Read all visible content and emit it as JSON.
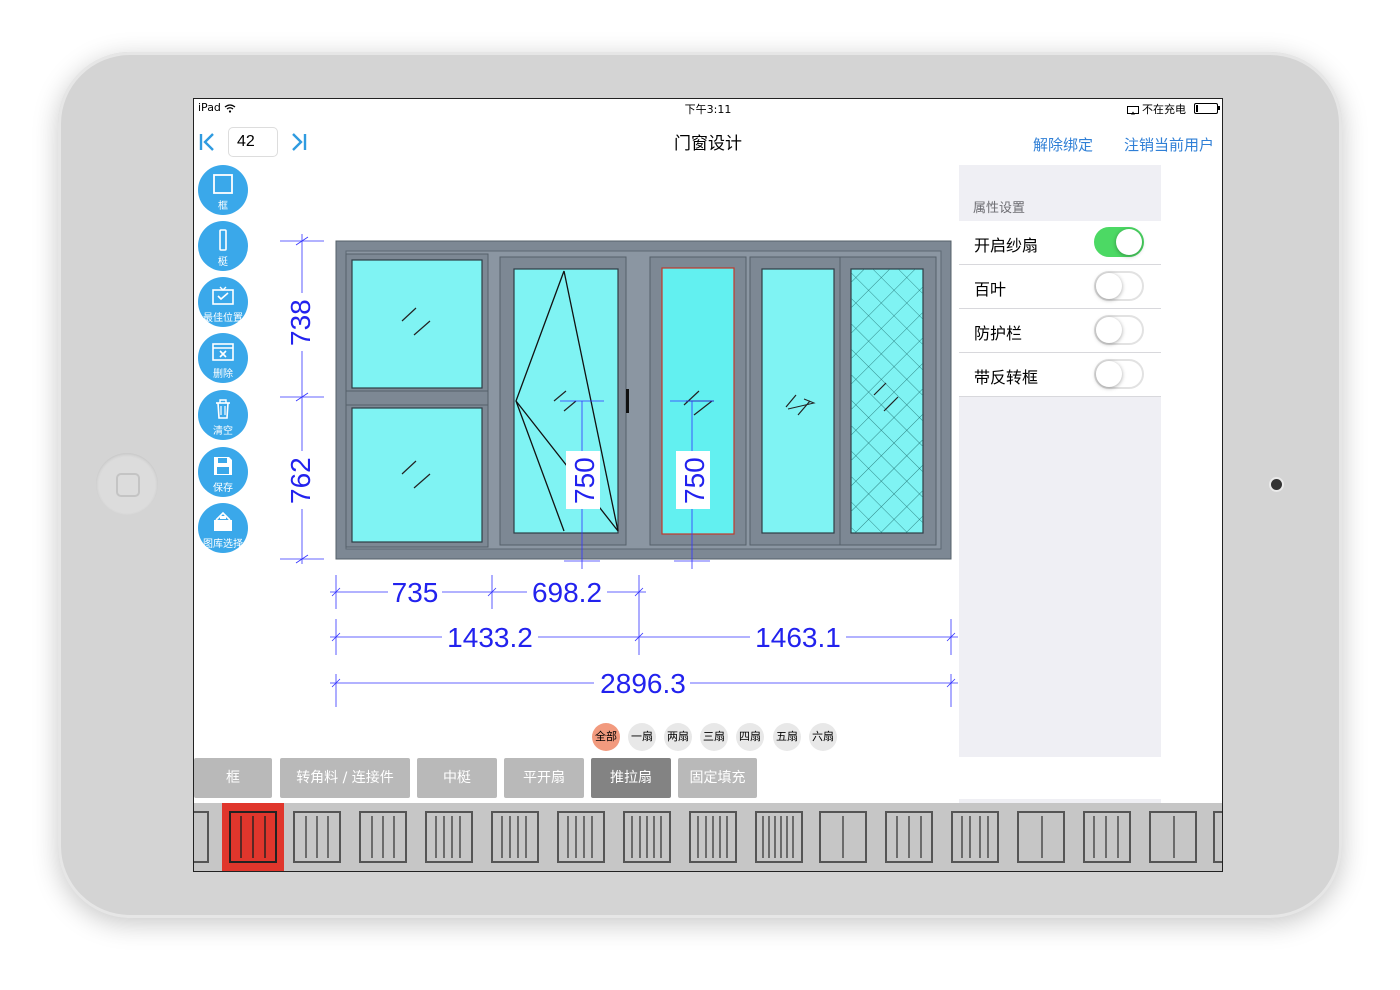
{
  "status": {
    "device": "iPad",
    "time": "下午3:11",
    "charging": "不在充电"
  },
  "nav": {
    "page_number": "42",
    "title": "门窗设计",
    "unbind_label": "解除绑定",
    "logout_label": "注销当前用户"
  },
  "tools": [
    {
      "label": "框",
      "icon": "frame-icon"
    },
    {
      "label": "梃",
      "icon": "mullion-icon"
    },
    {
      "label": "最佳位置",
      "icon": "best-position-icon"
    },
    {
      "label": "删除",
      "icon": "delete-icon"
    },
    {
      "label": "清空",
      "icon": "trash-icon"
    },
    {
      "label": "保存",
      "icon": "save-icon"
    },
    {
      "label": "图库选择",
      "icon": "gallery-icon"
    }
  ],
  "dimensions": {
    "left_top": "738",
    "left_bottom": "762",
    "sash_height_1": "750",
    "sash_height_2": "750",
    "row1_a": "735",
    "row1_b": "698.2",
    "row2_a": "1433.2",
    "row2_b": "1463.1",
    "total": "2896.3"
  },
  "panel": {
    "header": "属性设置",
    "options": [
      {
        "label": "开启纱扇",
        "on": true
      },
      {
        "label": "百叶",
        "on": false
      },
      {
        "label": "防护栏",
        "on": false
      },
      {
        "label": "带反转框",
        "on": false
      }
    ]
  },
  "filters": [
    "全部",
    "一扇",
    "两扇",
    "三扇",
    "四扇",
    "五扇",
    "六扇"
  ],
  "filter_active": "全部",
  "categories": [
    "框",
    "转角料 / 连接件",
    "中梃",
    "平开扇",
    "推拉扇",
    "固定填充"
  ],
  "category_active": "推拉扇",
  "colors": {
    "accent_blue": "#2f9be0",
    "glass": "#7ff3f3",
    "frame": "#7d8894",
    "dimension": "#2222ee",
    "toggle_on": "#4cd964",
    "selected_thumb": "#e0362c"
  }
}
